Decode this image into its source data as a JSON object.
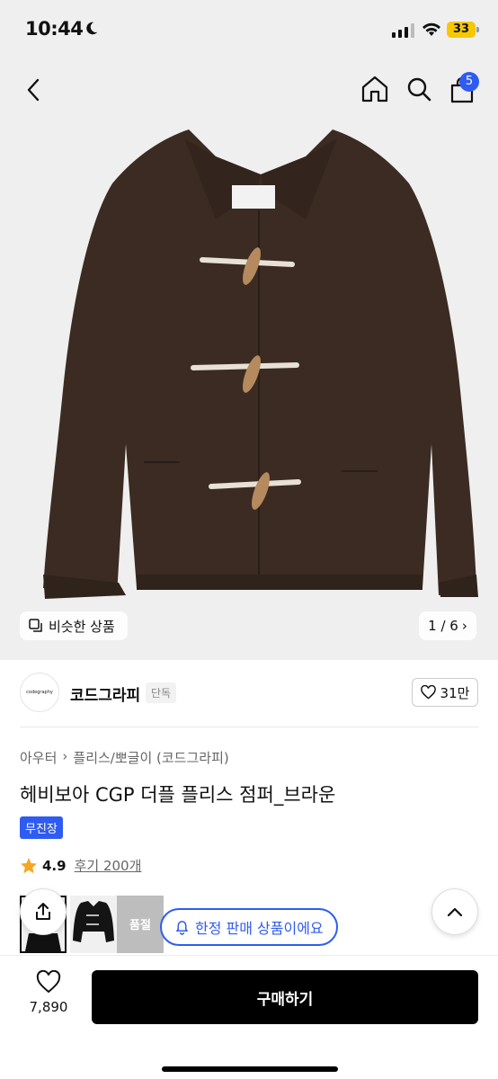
{
  "status_bar": {
    "time": "10:44",
    "battery": "33"
  },
  "nav": {
    "cart_count": "5"
  },
  "hero": {
    "similar_label": "비슷한 상품",
    "page_indicator": "1 / 6"
  },
  "brand": {
    "logo_text": "codegraphy",
    "name": "코드그라피",
    "badge": "단독",
    "likes": "31만"
  },
  "breadcrumb": [
    "아우터",
    "플리스/뽀글이 (코드그라피)"
  ],
  "product": {
    "title": "헤비보아 CGP 더플 플리스 점퍼_브라운",
    "tag": "무진장",
    "rating": "4.9",
    "reviews": "후기 200개"
  },
  "thumbs": {
    "soldout_label": "품절"
  },
  "limited_label": "한정 판매 상품이에요",
  "bottom": {
    "wish_count": "7,890",
    "buy_label": "구매하기"
  },
  "colors": {
    "accent": "#2f5cf0",
    "jacket": "#3b2b22",
    "star": "#f5a623"
  }
}
